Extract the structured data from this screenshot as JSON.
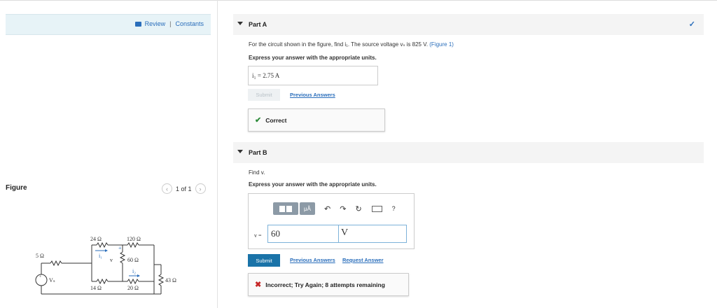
{
  "review": {
    "review_label": "Review",
    "separator": "|",
    "constants_label": "Constants"
  },
  "figure": {
    "title": "Figure",
    "pager_text": "1 of 1",
    "prev_icon": "chevron-left-icon",
    "next_icon": "chevron-right-icon",
    "circuit_labels": {
      "r5": "5 Ω",
      "r24": "24 Ω",
      "r120": "120 Ω",
      "r60": "60 Ω",
      "r14": "14 Ω",
      "r20": "20 Ω",
      "r43": "43 Ω",
      "i1": "i₁",
      "i2": "i₂",
      "v": "v",
      "vs": "Vₛ",
      "plus": "+",
      "minus": "−"
    }
  },
  "partA": {
    "title": "Part A",
    "status_icon": "checkmark-icon",
    "question_pre": "For the circuit shown in the figure, find i₁. The source voltage vₛ is 825 V. ",
    "figure_link": "(Figure 1)",
    "instruction": "Express your answer with the appropriate units.",
    "answer": "i₁ =  2.75 A",
    "submit_label": "Submit",
    "previous_answers_label": "Previous Answers",
    "feedback": "Correct"
  },
  "partB": {
    "title": "Part B",
    "question": "Find v.",
    "instruction": "Express your answer with the appropriate units.",
    "toolbar": {
      "mu_label": "μÅ",
      "help_label": "?"
    },
    "eq_label": "v =",
    "value": "60",
    "unit": "V",
    "submit_label": "Submit",
    "previous_answers_label": "Previous Answers",
    "request_answer_label": "Request Answer",
    "feedback": "Incorrect; Try Again; 8 attempts remaining"
  },
  "colors": {
    "accent": "#2a6ebb",
    "submit": "#1a73a8",
    "correct": "#2e8b3a",
    "incorrect": "#c62828"
  }
}
